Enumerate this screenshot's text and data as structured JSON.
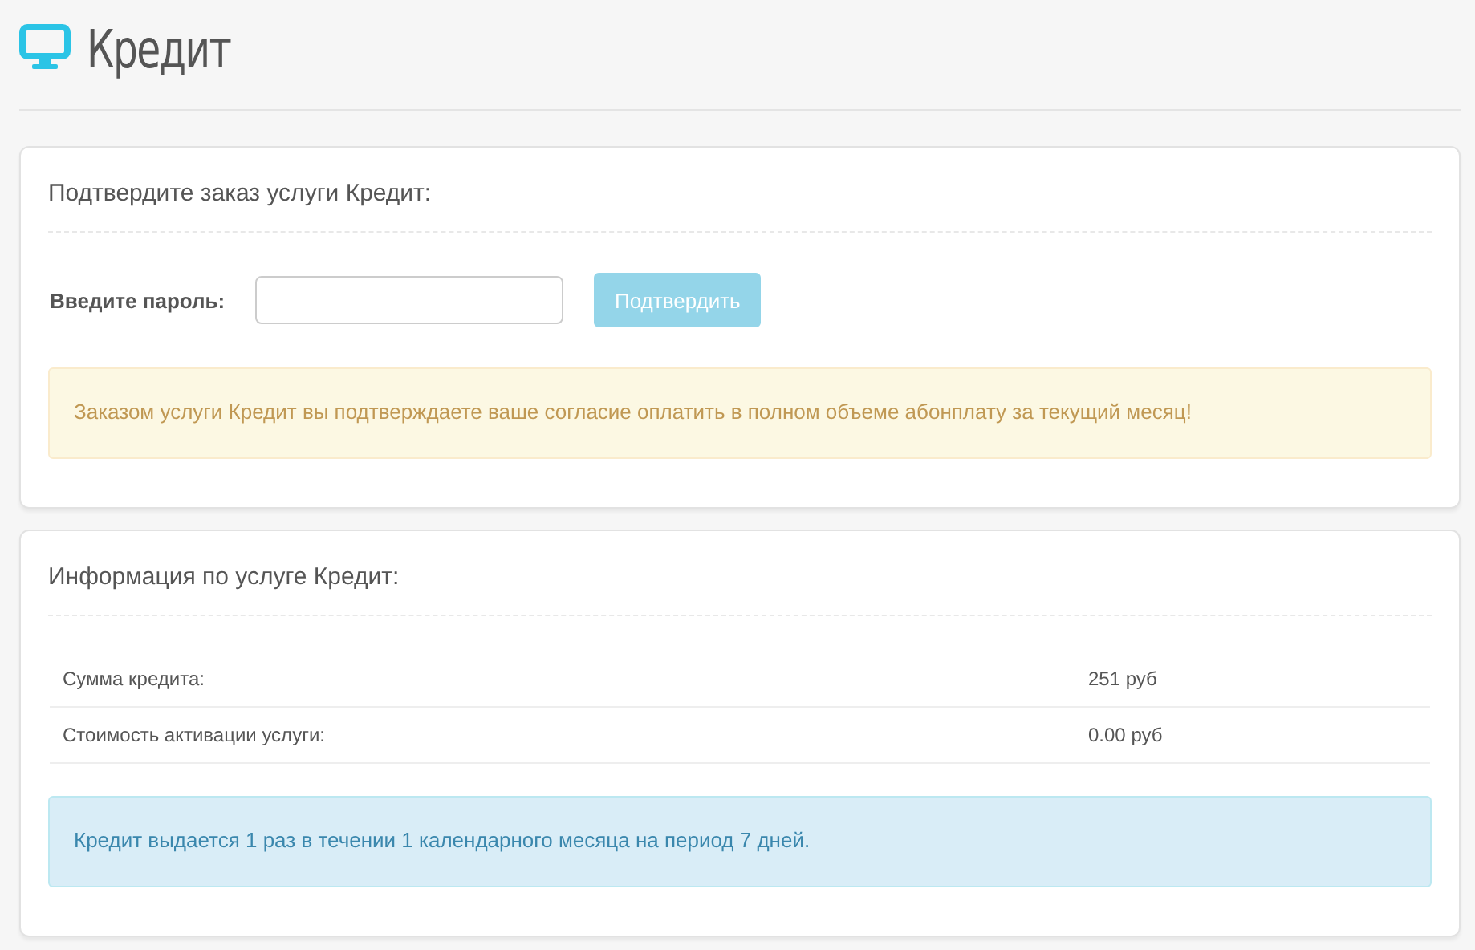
{
  "page": {
    "title": "Кредит"
  },
  "confirm_panel": {
    "heading": "Подтвердите заказ услуги Кредит:",
    "password_label": "Введите пароль:",
    "confirm_button": {
      "label": "Подтвердить",
      "disabled": true
    },
    "alert": {
      "kind": "warning",
      "text": "Заказом услуги Кредит вы подтверждаете ваше согласие оплатить в полном объеме абонплату за текущий месяц!"
    }
  },
  "info_panel": {
    "heading": "Информация по услуге Кредит:",
    "rows": [
      {
        "label": "Сумма кредита:",
        "value": "251 руб"
      },
      {
        "label": "Стоимость активации услуги:",
        "value": "0.00 руб"
      }
    ],
    "alert": {
      "kind": "info",
      "text": "Кредит выдается 1 раз в течении 1 календарного месяца на период 7 дней."
    }
  }
}
